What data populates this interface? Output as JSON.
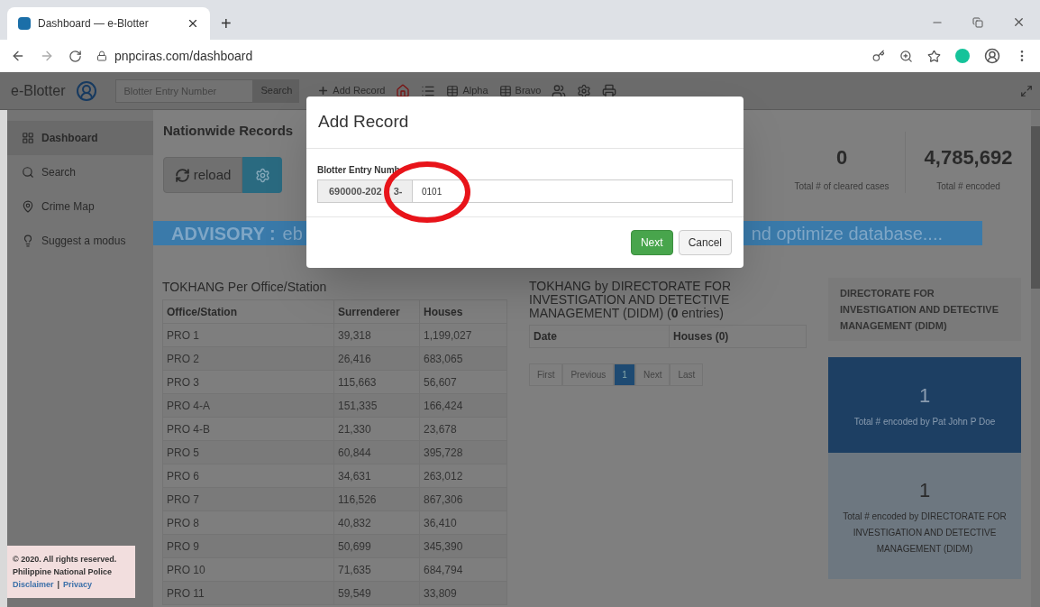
{
  "browser": {
    "tab_title": "Dashboard — e-Blotter",
    "new_tab": "+",
    "url": "pnpciras.com/dashboard"
  },
  "navbar": {
    "brand": "e-Blotter",
    "search_placeholder": "Blotter Entry Number",
    "search_button": "Search",
    "links": [
      "Add Record",
      "Alpha",
      "Bravo"
    ]
  },
  "sidebar": {
    "items": [
      {
        "label": "Dashboard",
        "selected": true
      },
      {
        "label": "Search",
        "selected": false
      },
      {
        "label": "Crime Map",
        "selected": false
      },
      {
        "label": "Suggest a modus",
        "selected": false
      }
    ],
    "footer": {
      "copyright": "© 2020. All rights reserved.",
      "organization": "Philippine National Police",
      "links": [
        "Disclaimer",
        "Privacy"
      ],
      "separator": "|"
    }
  },
  "main": {
    "title": "Nationwide Records",
    "reload_button": "reload",
    "stats": [
      {
        "value": "0",
        "label": "Total # of cleared cases"
      },
      {
        "value": "4,785,692",
        "label": "Total # encoded"
      }
    ],
    "advisory": {
      "label": "ADVISORY :",
      "message_start": "eb",
      "message_end": "nd optimize database...."
    },
    "tokhang_table": {
      "title": "TOKHANG Per Office/Station",
      "columns": [
        "Office/Station",
        "Surrenderer",
        "Houses"
      ],
      "rows": [
        [
          "PRO 1",
          "39,318",
          "1,199,027"
        ],
        [
          "PRO 2",
          "26,416",
          "683,065"
        ],
        [
          "PRO 3",
          "115,663",
          "56,607"
        ],
        [
          "PRO 4-A",
          "151,335",
          "166,424"
        ],
        [
          "PRO 4-B",
          "21,330",
          "23,678"
        ],
        [
          "PRO 5",
          "60,844",
          "395,728"
        ],
        [
          "PRO 6",
          "34,631",
          "263,012"
        ],
        [
          "PRO 7",
          "116,526",
          "867,306"
        ],
        [
          "PRO 8",
          "40,832",
          "36,410"
        ],
        [
          "PRO 9",
          "50,699",
          "345,390"
        ],
        [
          "PRO 10",
          "71,635",
          "684,794"
        ],
        [
          "PRO 11",
          "59,549",
          "33,809"
        ]
      ]
    },
    "didm": {
      "title": "TOKHANG by DIRECTORATE FOR INVESTIGATION AND DETECTIVE MANAGEMENT (DIDM) (**0** entries)",
      "columns": [
        "Date",
        "Houses (0)"
      ],
      "pagination": [
        {
          "label": "First",
          "selected": false
        },
        {
          "label": "Previous",
          "selected": false
        },
        {
          "label": "1",
          "selected": true
        },
        {
          "label": "Next",
          "selected": false
        },
        {
          "label": "Last",
          "selected": false
        }
      ]
    },
    "unit_card": {
      "header": "DIRECTORATE FOR INVESTIGATION AND DETECTIVE MANAGEMENT (DIDM)",
      "tiles": [
        {
          "kind": "primary",
          "value": "1",
          "label": "Total # encoded by Pat John P Doe"
        },
        {
          "kind": "secondary",
          "value": "1",
          "label": "Total # encoded by DIRECTORATE FOR INVESTIGATION AND DETECTIVE MANAGEMENT (DIDM)"
        }
      ]
    }
  },
  "modal": {
    "title": "Add Record",
    "field_label": "Blotter Entry Numb",
    "prefix_parts": [
      "690000-202",
      "3-"
    ],
    "value": "0101",
    "buttons": [
      {
        "kind": "primary",
        "label": "Next"
      },
      {
        "kind": "default",
        "label": "Cancel"
      }
    ]
  }
}
